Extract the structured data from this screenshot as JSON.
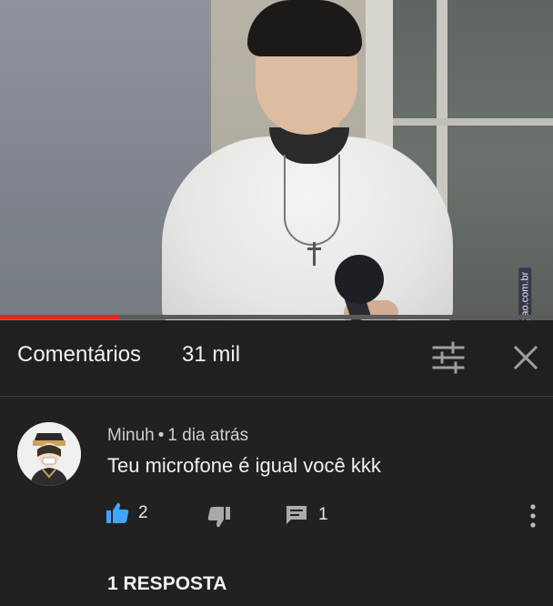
{
  "video": {
    "watermark": "AhNegao.com.br",
    "progress_fraction": 0.215
  },
  "comments_panel": {
    "title": "Comentários",
    "count": "31 mil",
    "sort_icon": "sort-sliders-icon",
    "close_icon": "close-icon"
  },
  "comment": {
    "author": "Minuh",
    "separator": "•",
    "time": "1 dia atrás",
    "text": "Teu microfone é igual você kkk",
    "likes": "2",
    "replies": "1",
    "replies_link": "1 RESPOSTA"
  },
  "colors": {
    "background": "#212121",
    "like_active": "#3ea6ff",
    "progress": "#e52521",
    "text": "#f1f1f1"
  }
}
